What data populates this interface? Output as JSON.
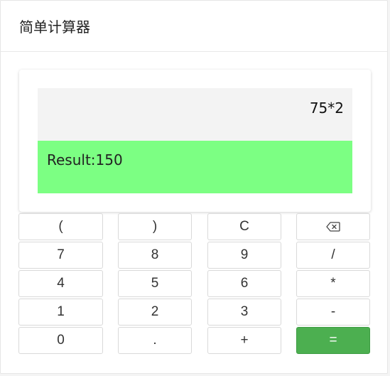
{
  "app": {
    "title": "简单计算器"
  },
  "display": {
    "expression": "75*2",
    "result": "Result:150"
  },
  "keys": {
    "open_paren": "(",
    "close_paren": ")",
    "clear": "C",
    "backspace_icon": "backspace-icon",
    "seven": "7",
    "eight": "8",
    "nine": "9",
    "divide": "/",
    "four": "4",
    "five": "5",
    "six": "6",
    "multiply": "*",
    "one": "1",
    "two": "2",
    "three": "3",
    "minus": "-",
    "zero": "0",
    "dot": ".",
    "plus": "+",
    "equals": "="
  },
  "colors": {
    "result_bg": "#7cff83",
    "expression_bg": "#f3f3f3",
    "equals_bg": "#4caf50"
  }
}
